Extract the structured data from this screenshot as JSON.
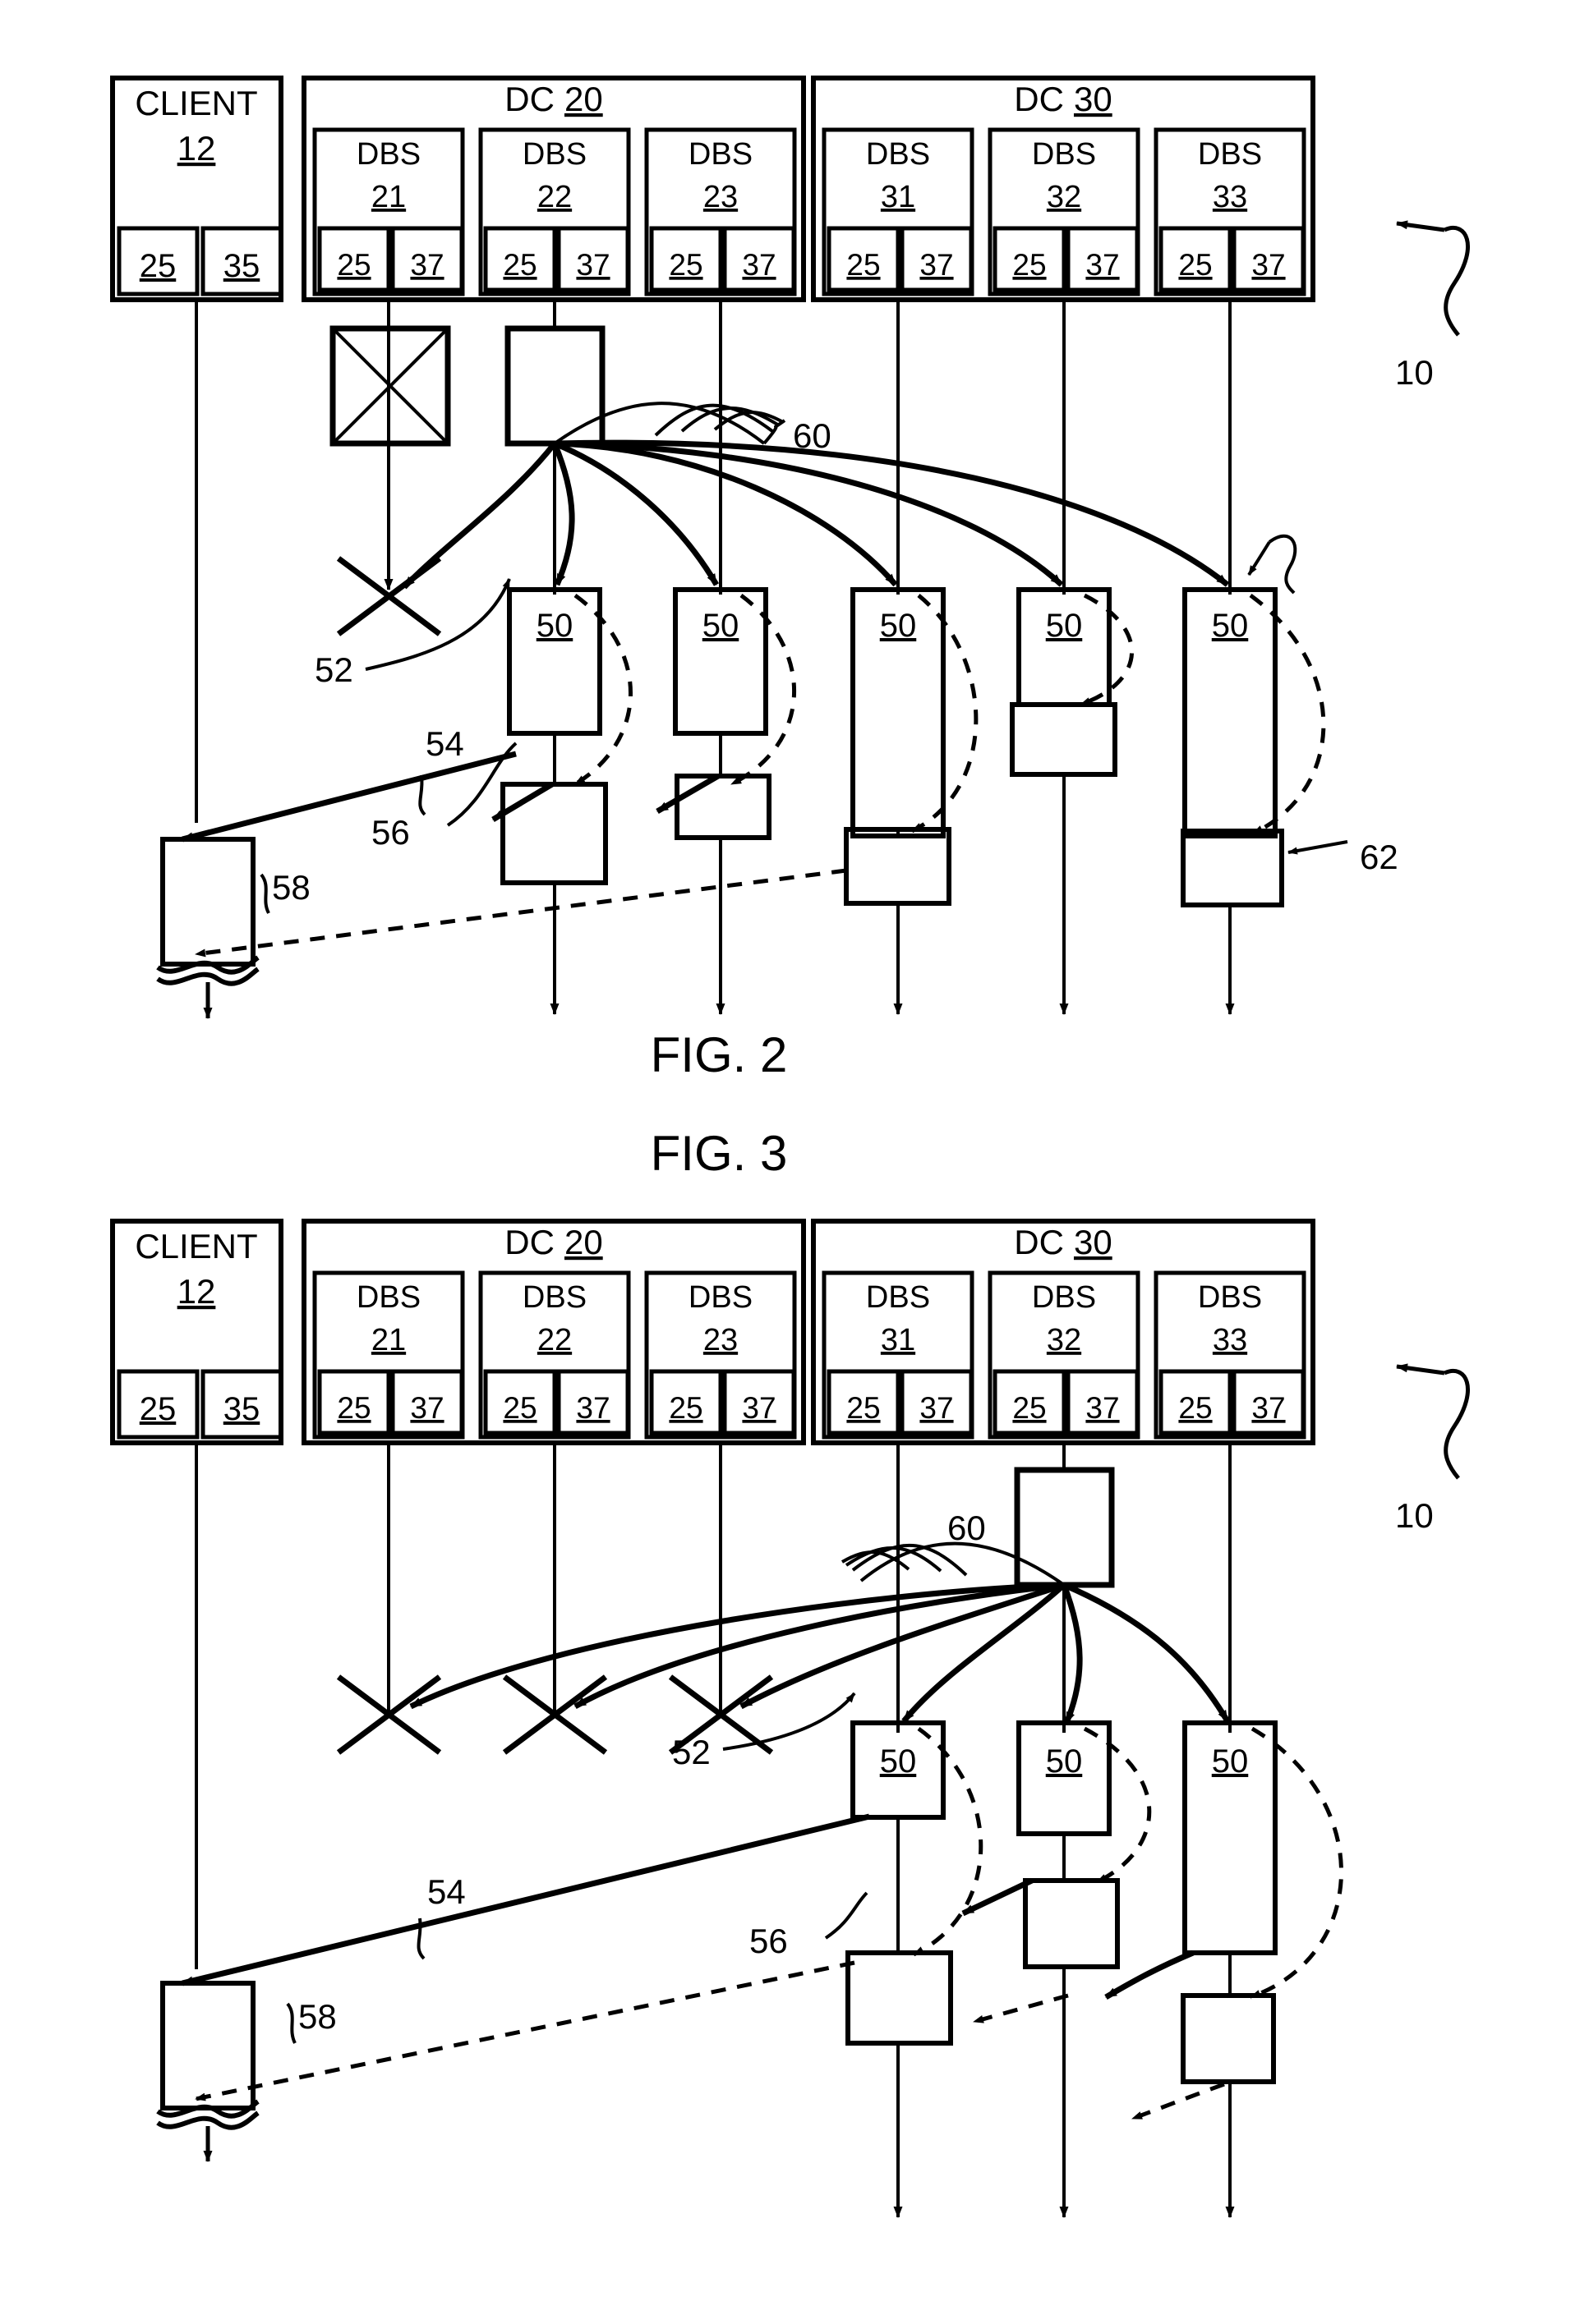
{
  "document": {
    "kind": "patent-drawing-sheet",
    "figures": [
      "FIG. 2",
      "FIG. 3"
    ]
  },
  "figures": [
    {
      "caption": "FIG. 2",
      "system_ref": "10",
      "client": {
        "title": "CLIENT",
        "ref": "12",
        "ports": [
          "25",
          "35"
        ]
      },
      "datacenters": [
        {
          "label": "DC",
          "ref": "20",
          "servers": [
            {
              "title": "DBS",
              "ref": "21",
              "ports": [
                "25",
                "37"
              ]
            },
            {
              "title": "DBS",
              "ref": "22",
              "ports": [
                "25",
                "37"
              ]
            },
            {
              "title": "DBS",
              "ref": "23",
              "ports": [
                "25",
                "37"
              ]
            }
          ]
        },
        {
          "label": "DC",
          "ref": "30",
          "servers": [
            {
              "title": "DBS",
              "ref": "31",
              "ports": [
                "25",
                "37"
              ]
            },
            {
              "title": "DBS",
              "ref": "32",
              "ports": [
                "25",
                "37"
              ]
            },
            {
              "title": "DBS",
              "ref": "33",
              "ports": [
                "25",
                "37"
              ]
            }
          ]
        }
      ],
      "activation_label": "50",
      "callouts": [
        {
          "ref": "52",
          "meaning": "failed-request-marker"
        },
        {
          "ref": "54",
          "meaning": "response-to-client"
        },
        {
          "ref": "56",
          "meaning": "secondary-activation"
        },
        {
          "ref": "58",
          "meaning": "dashed-return-to-client"
        },
        {
          "ref": "60",
          "meaning": "broadcast-fan-out"
        },
        {
          "ref": "62",
          "meaning": "dashed-feedback-loop"
        },
        {
          "ref": "10",
          "meaning": "system-reference"
        }
      ],
      "coordinator_column": "22",
      "cancelled_columns": [
        "21"
      ]
    },
    {
      "caption": "FIG. 3",
      "system_ref": "10",
      "client": {
        "title": "CLIENT",
        "ref": "12",
        "ports": [
          "25",
          "35"
        ]
      },
      "datacenters": [
        {
          "label": "DC",
          "ref": "20",
          "servers": [
            {
              "title": "DBS",
              "ref": "21",
              "ports": [
                "25",
                "37"
              ]
            },
            {
              "title": "DBS",
              "ref": "22",
              "ports": [
                "25",
                "37"
              ]
            },
            {
              "title": "DBS",
              "ref": "23",
              "ports": [
                "25",
                "37"
              ]
            }
          ]
        },
        {
          "label": "DC",
          "ref": "30",
          "servers": [
            {
              "title": "DBS",
              "ref": "31",
              "ports": [
                "25",
                "37"
              ]
            },
            {
              "title": "DBS",
              "ref": "32",
              "ports": [
                "25",
                "37"
              ]
            },
            {
              "title": "DBS",
              "ref": "33",
              "ports": [
                "25",
                "37"
              ]
            }
          ]
        }
      ],
      "activation_label": "50",
      "callouts": [
        {
          "ref": "52",
          "meaning": "failed-request-marker"
        },
        {
          "ref": "54",
          "meaning": "response-to-client"
        },
        {
          "ref": "56",
          "meaning": "secondary-activation"
        },
        {
          "ref": "58",
          "meaning": "dashed-return-to-client"
        },
        {
          "ref": "60",
          "meaning": "broadcast-fan-out"
        },
        {
          "ref": "10",
          "meaning": "system-reference"
        }
      ],
      "coordinator_column": "32",
      "cancelled_columns": [
        "21",
        "22",
        "23"
      ]
    }
  ]
}
